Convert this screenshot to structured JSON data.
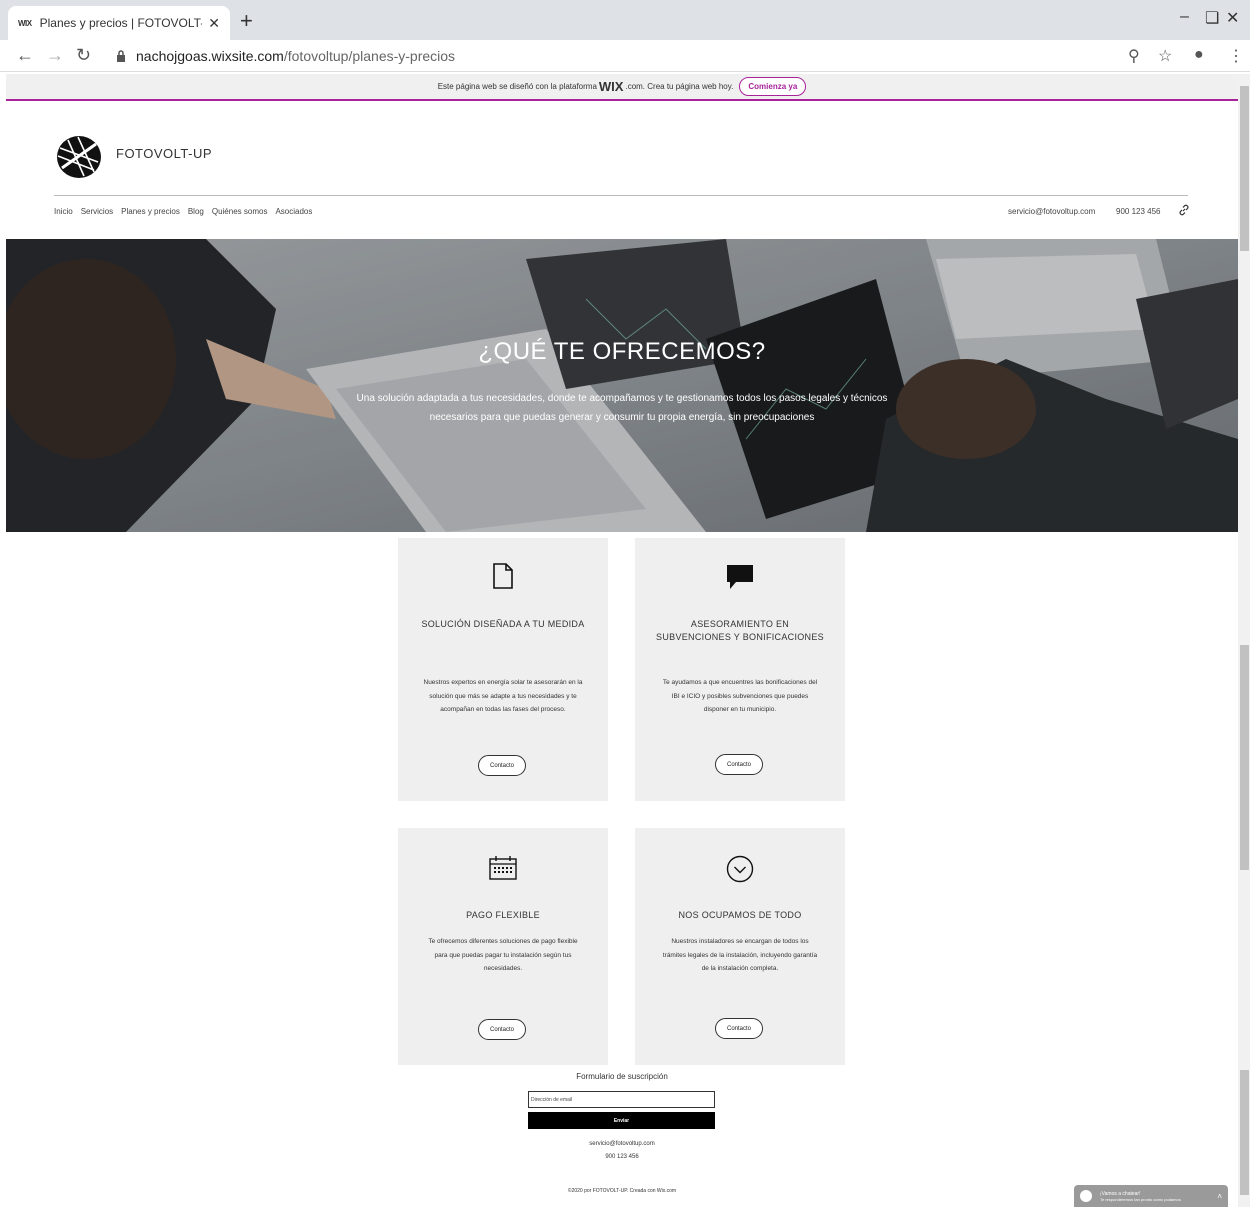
{
  "browser": {
    "tab_favicon": "WIX",
    "tab_title": "Planes y precios | FOTOVOLT-UP",
    "tab_close": "✕",
    "new_tab": "+",
    "url_host": "nachojgoas.wixsite.com",
    "url_path": "/fotovoltup/planes-y-precios"
  },
  "wix_banner": {
    "text_before": "Este página web se diseñó con la plataforma",
    "brand": "WIX",
    "text_after": ".com. Crea tu página web hoy.",
    "cta": "Comienza ya"
  },
  "header": {
    "brand": "FOTOVOLT-UP",
    "menu": [
      "Inicio",
      "Servicios",
      "Planes y precios",
      "Blog",
      "Quiénes somos",
      "Asociados"
    ],
    "email": "servicio@fotovoltup.com",
    "phone": "900 123 456"
  },
  "hero": {
    "title": "¿QUÉ TE OFRECEMOS?",
    "subtitle": "Una solución adaptada a tus necesidades, donde te acompañamos y te gestionamos todos los pasos legales y técnicos necesarios para que puedas generar y consumir tu propia energía, sin preocupaciones"
  },
  "cards": [
    {
      "icon": "document-icon",
      "title": "SOLUCIÓN DISEÑADA A TU MEDIDA",
      "body": "Nuestros expertos en energía solar te asesorarán en la solución que más se adapte a tus necesidades y te acompañan en todas las fases del proceso.",
      "button": "Contacto"
    },
    {
      "icon": "chat-icon",
      "title": "ASESORAMIENTO EN SUBVENCIONES Y BONIFICACIONES",
      "body": "Te ayudamos a que encuentres las bonificaciones del IBI e ICIO y posibles subvenciones que puedes disponer en tu municipio.",
      "button": "Contacto"
    },
    {
      "icon": "calendar-icon",
      "title": "PAGO FLEXIBLE",
      "body": "Te ofrecemos diferentes soluciones de pago flexible para que puedas pagar tu instalación según tus necesidades.",
      "button": "Contacto"
    },
    {
      "icon": "check-circle-icon",
      "title": "NOS OCUPAMOS DE TODO",
      "body": "Nuestros instaladores se encargan de todos los trámites legales de la instalación, incluyendo garantía de la instalación completa.",
      "button": "Contacto"
    }
  ],
  "footer": {
    "form_title": "Formulario de suscripción",
    "email_placeholder": "Dirección de email",
    "send": "Enviar",
    "email": "servicio@fotovoltup.com",
    "phone": "900 123 456",
    "copyright": "©2020 por FOTOVOLT-UP. Creada con Wix.com"
  },
  "chat": {
    "title": "¡Vamos a chatear!",
    "subtitle": "Te responderemos tan pronto como podamos"
  }
}
